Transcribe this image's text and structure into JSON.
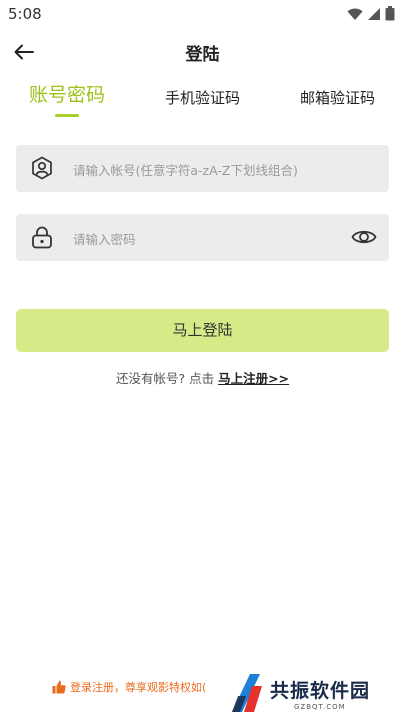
{
  "status_bar": {
    "time": "5:08"
  },
  "header": {
    "title": "登陆"
  },
  "tabs": [
    {
      "label": "账号密码",
      "active": true
    },
    {
      "label": "手机验证码",
      "active": false
    },
    {
      "label": "邮箱验证码",
      "active": false
    }
  ],
  "form": {
    "account": {
      "placeholder": "请输入帐号(任意字符a-zA-Z下划线组合)",
      "value": ""
    },
    "password": {
      "placeholder": "请输入密码",
      "value": ""
    }
  },
  "login_button": "马上登陆",
  "register": {
    "prompt": "还没有帐号? 点击",
    "link": "马上注册>>"
  },
  "footer": {
    "promo": "登录注册，尊享观影特权如("
  },
  "watermark": {
    "title": "共振软件园",
    "subtitle": "GZBQT.COM"
  },
  "colors": {
    "accent": "#9cc21b",
    "button_bg": "#d6ea88",
    "field_bg": "#ececec",
    "promo": "#ec6a1c"
  },
  "icons": {
    "back": "arrow-left-icon",
    "account": "user-icon",
    "password": "lock-icon",
    "visibility": "eye-icon",
    "promo": "thumbs-up-icon"
  }
}
